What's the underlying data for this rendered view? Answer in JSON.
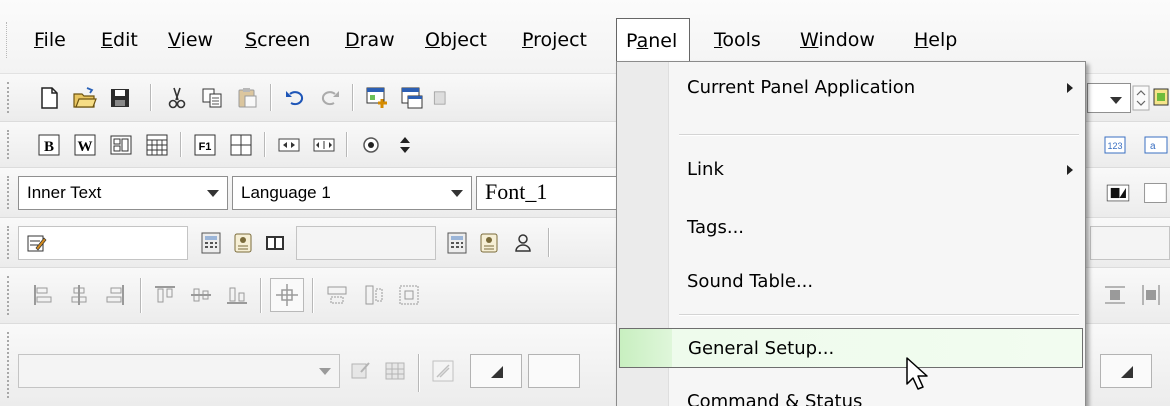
{
  "menubar": {
    "items": [
      {
        "label": "File",
        "acc": "F",
        "rest": "ile"
      },
      {
        "label": "Edit",
        "acc": "E",
        "rest": "dit"
      },
      {
        "label": "View",
        "acc": "V",
        "rest": "iew"
      },
      {
        "label": "Screen",
        "acc": "S",
        "rest": "creen"
      },
      {
        "label": "Draw",
        "acc": "D",
        "rest": "raw"
      },
      {
        "label": "Object",
        "acc": "O",
        "rest": "bject"
      },
      {
        "label": "Project",
        "acc": "P",
        "rest": "roject"
      },
      {
        "label": "Panel",
        "pre": "P",
        "acc": "a",
        "rest": "nel"
      },
      {
        "label": "Tools",
        "acc": "T",
        "rest": "ools"
      },
      {
        "label": "Window",
        "acc": "W",
        "rest": "indow"
      },
      {
        "label": "Help",
        "acc": "H",
        "rest": "elp"
      }
    ]
  },
  "toolbar": {
    "text_style": "Inner Text",
    "language": "Language 1",
    "font": "Font_1",
    "icons_row1": [
      "new-file-icon",
      "open-folder-icon",
      "save-icon",
      "cut-icon",
      "copy-icon",
      "paste-icon",
      "undo-icon",
      "redo-icon",
      "add-screen-icon",
      "screen-properties-icon"
    ],
    "icons_row2": [
      "bold-icon",
      "word-icon",
      "layout-icon",
      "grid-icon",
      "function-key-icon",
      "table-icon",
      "step-left-icon",
      "step-right-icon",
      "radio-icon",
      "updown-icon"
    ],
    "icons_row3": [
      "edit-object-icon",
      "calculator-icon",
      "tag-icon",
      "book-icon",
      "calculator-icon",
      "tag-icon",
      "user-icon"
    ],
    "icons_row4": [
      "align-left-icon",
      "align-center-icon",
      "align-right-icon",
      "align-top-icon",
      "align-middle-icon",
      "align-bottom-icon",
      "center-icon",
      "distribute-h-icon",
      "distribute-v-icon",
      "group-icon"
    ]
  },
  "panel_menu": {
    "items": [
      {
        "label": "Current Panel Application",
        "submenu": true
      },
      {
        "label": "Link",
        "submenu": true
      },
      {
        "label": "Tags..."
      },
      {
        "label": "Sound Table..."
      },
      {
        "label": "General Setup...",
        "highlighted": true
      },
      {
        "label": "Command & Status"
      }
    ],
    "highlight_color": "#c8efc0"
  },
  "colors": {
    "menubar_bg": "#f7f7f7",
    "toolbar_bg": "#f0f0f0",
    "menu_border": "#8b8b8b",
    "highlight_green": "#c8efc0"
  }
}
